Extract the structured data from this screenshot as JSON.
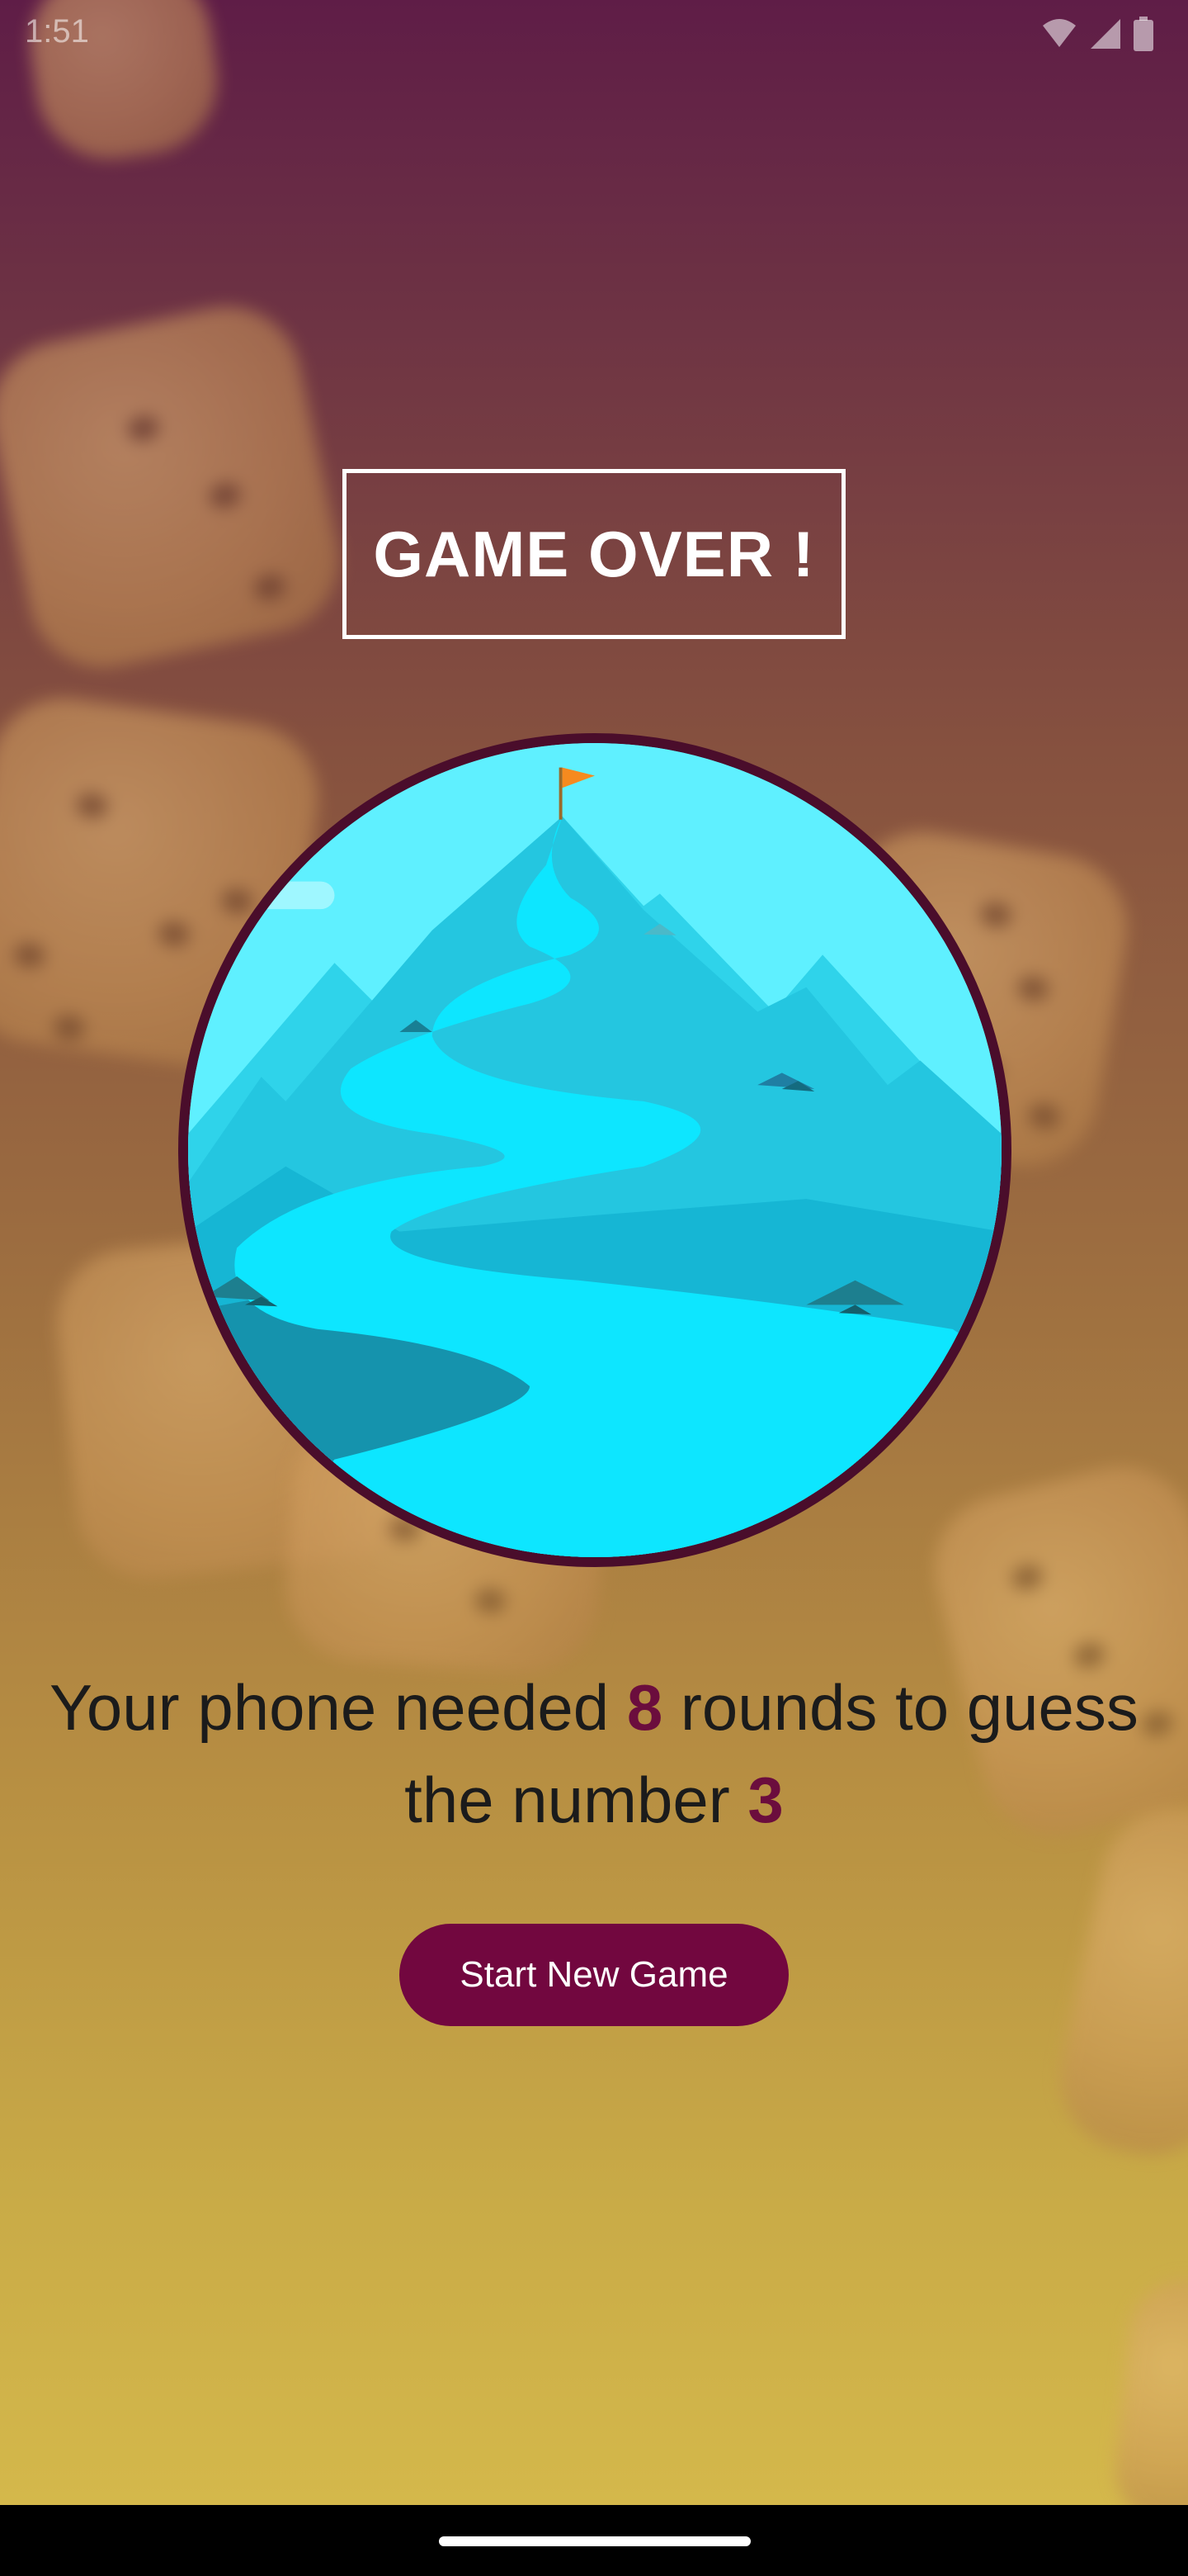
{
  "status_bar": {
    "time": "1:51",
    "icons": [
      "wifi-icon",
      "cellular-signal-icon",
      "battery-icon"
    ]
  },
  "screen": {
    "title": "GAME OVER !",
    "illustration": "mountain-summit-flag-illustration",
    "summary": {
      "prefix": "Your phone needed ",
      "rounds": "8",
      "middle": " rounds to guess the number ",
      "number": "3"
    },
    "start_button_label": "Start New Game"
  },
  "colors": {
    "accent": "#72073f",
    "highlight_number": "#6b0d3d",
    "circle_border": "#4a0d2b",
    "gradient_top": "#5f1d47",
    "gradient_bottom": "#d4b84b"
  }
}
